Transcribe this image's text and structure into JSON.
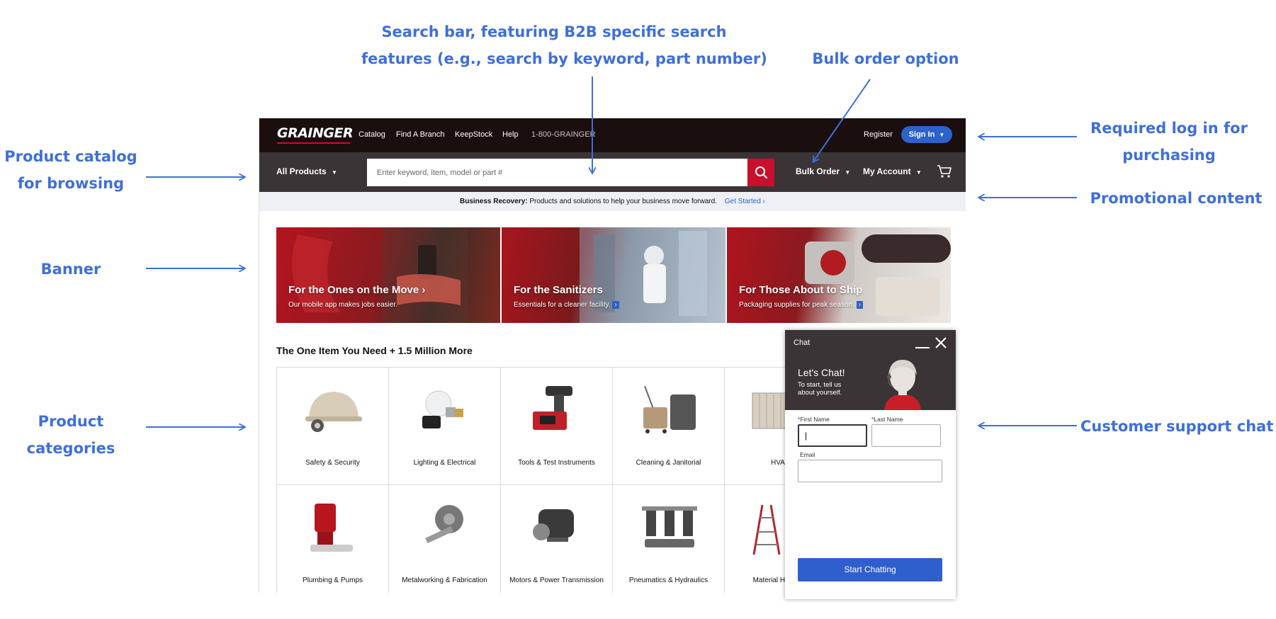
{
  "annotations": {
    "search_bar": [
      "Search bar, featuring B2B specific search",
      "features (e.g., search by keyword, part number)"
    ],
    "bulk_order": "Bulk order option",
    "product_catalog": [
      "Product catalog",
      "for browsing"
    ],
    "required_login": [
      "Required log in for",
      "purchasing"
    ],
    "promotional": "Promotional content",
    "banner": "Banner",
    "product_categories": [
      "Product",
      "categories"
    ],
    "support_chat": "Customer support chat",
    "color": "#3f6fd8"
  },
  "header": {
    "logo": "GRAINGER",
    "nav": [
      "Catalog",
      "Find A Branch",
      "KeepStock",
      "Help"
    ],
    "phone": "1-800-GRAINGER",
    "register": "Register",
    "sign_in": "Sign In",
    "all_products": "All Products",
    "search_placeholder": "Enter keyword, item, model or part #",
    "bulk_order": "Bulk Order",
    "my_account": "My Account",
    "cart_icon": "cart-icon"
  },
  "promo": {
    "bold": "Business Recovery:",
    "text": "Products and solutions to help your business move forward.",
    "link": "Get Started"
  },
  "banners": [
    {
      "title": "For the Ones on the Move",
      "subtitle": "Our mobile app makes jobs easier."
    },
    {
      "title": "For the Sanitizers",
      "subtitle": "Essentials for a cleaner facility."
    },
    {
      "title": "For Those About to Ship",
      "subtitle": "Packaging supplies for peak season."
    }
  ],
  "categories_title": "The One Item You Need + 1.5 Million More",
  "categories": [
    "Safety & Security",
    "Lighting & Electrical",
    "Tools & Test Instruments",
    "Cleaning & Janitorial",
    "HVAC",
    "Plumbing & Pumps",
    "Metalworking & Fabrication",
    "Motors & Power Transmission",
    "Pneumatics & Hydraulics",
    "Material Handling"
  ],
  "chat": {
    "title": "Chat",
    "heading": "Let's Chat!",
    "subtext": "To start, tell us about yourself.",
    "first_name_label": "First Name",
    "last_name_label": "Last Name",
    "email_label": "Email",
    "required_mark": "*",
    "first_name_value": "|",
    "button": "Start Chatting"
  },
  "colors": {
    "brand_red": "#c8102e",
    "sign_in_blue": "#2c62c9",
    "header_dark": "#1a0e0f",
    "bar_gray": "#3a3436"
  }
}
